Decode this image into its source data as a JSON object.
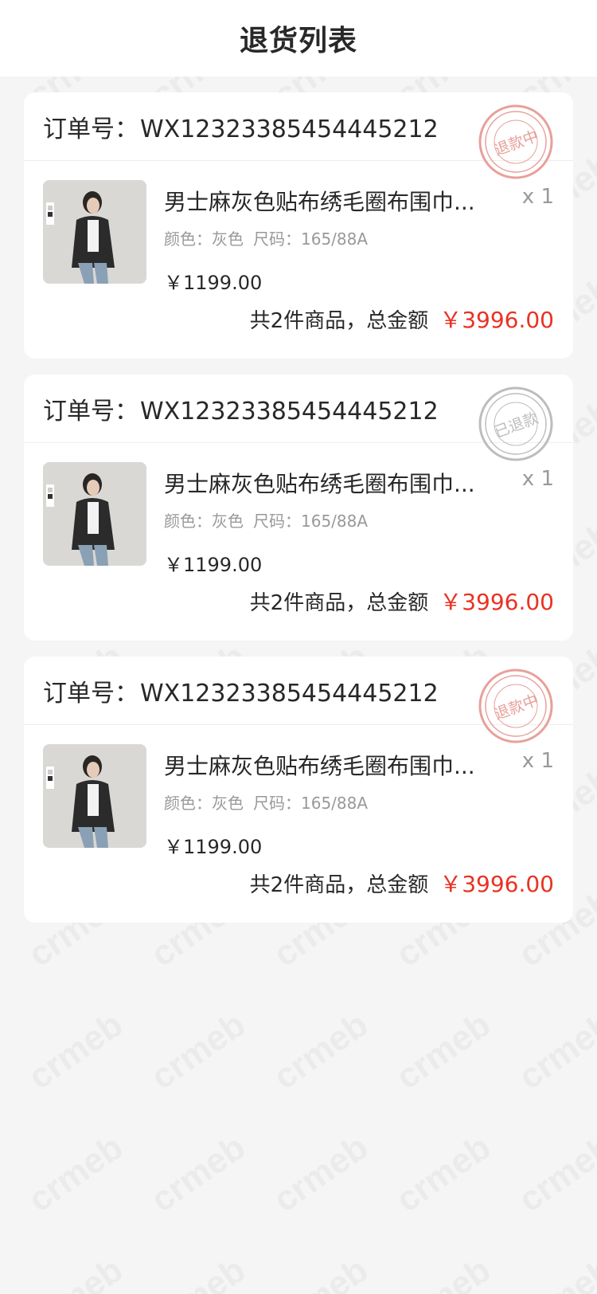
{
  "header": {
    "title": "退货列表"
  },
  "watermark": {
    "text": "crmeb"
  },
  "orders": [
    {
      "order_label": "订单号：",
      "order_no": "WX12323385454445212",
      "stamp_text": "退款中",
      "stamp_color": "#e8a09a",
      "goods_name": "男士麻灰色贴布绣毛圈布围巾...",
      "qty": "x 1",
      "color_label": "颜色：灰色",
      "size_label": "尺码：165/88A",
      "price": "￥1199.00",
      "summary_text": "共2件商品，总金额",
      "total": "￥3996.00"
    },
    {
      "order_label": "订单号：",
      "order_no": "WX12323385454445212",
      "stamp_text": "已退款",
      "stamp_color": "#bdbdbd",
      "goods_name": "男士麻灰色贴布绣毛圈布围巾...",
      "qty": "x 1",
      "color_label": "颜色：灰色",
      "size_label": "尺码：165/88A",
      "price": "￥1199.00",
      "summary_text": "共2件商品，总金额",
      "total": "￥3996.00"
    },
    {
      "order_label": "订单号：",
      "order_no": "WX12323385454445212",
      "stamp_text": "退款中",
      "stamp_color": "#e8a09a",
      "goods_name": "男士麻灰色贴布绣毛圈布围巾...",
      "qty": "x 1",
      "color_label": "颜色：灰色",
      "size_label": "尺码：165/88A",
      "price": "￥1199.00",
      "summary_text": "共2件商品，总金额",
      "total": "￥3996.00"
    }
  ],
  "colors": {
    "accent": "#e93323",
    "background": "#f5f5f5"
  }
}
